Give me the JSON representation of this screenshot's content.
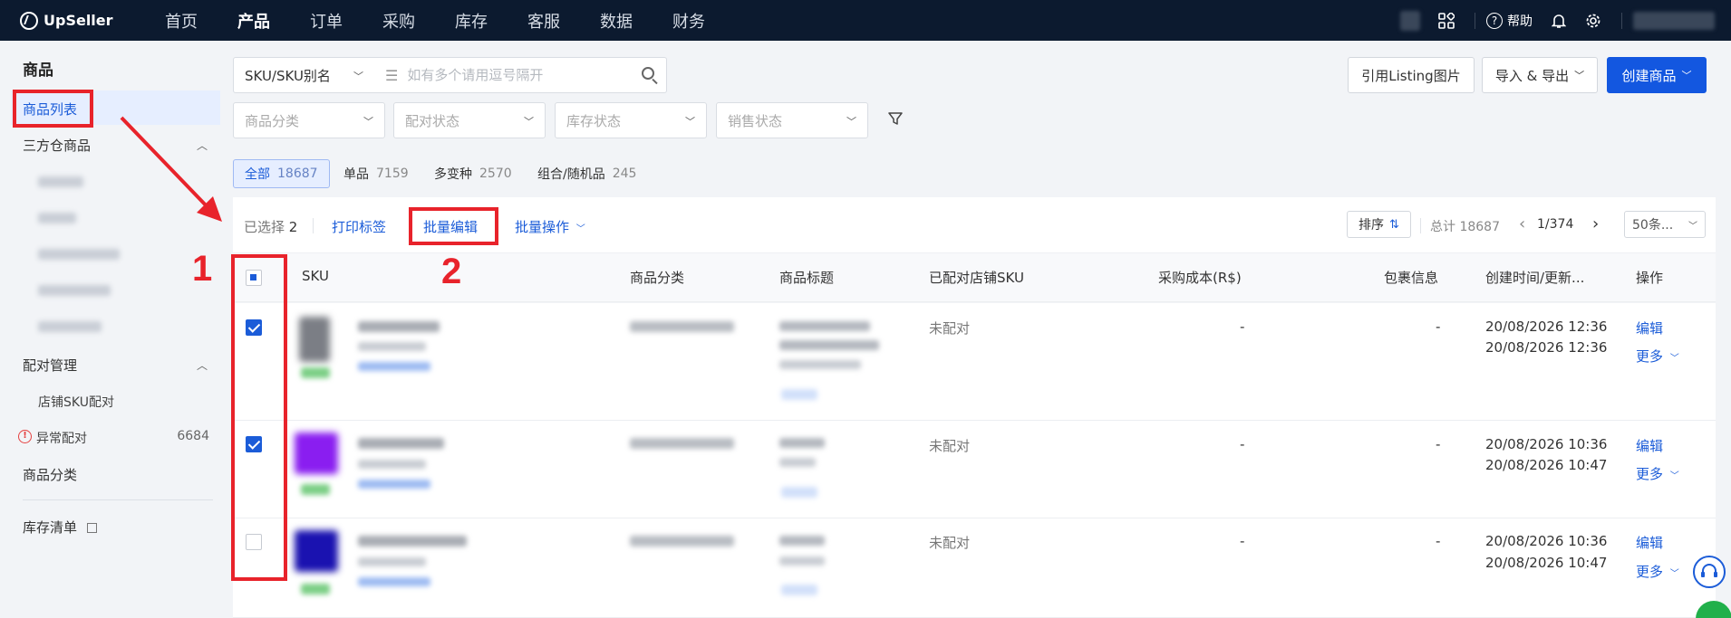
{
  "brand": "UpSeller",
  "nav": [
    "首页",
    "产品",
    "订单",
    "采购",
    "库存",
    "客服",
    "数据",
    "财务"
  ],
  "nav_active_index": 1,
  "topbar": {
    "help": "帮助"
  },
  "sidebar": {
    "title": "商品",
    "items": {
      "product_list": "商品列表",
      "third_party": "三方仓商品",
      "pairing": "配对管理",
      "store_sku": "店铺SKU配对",
      "abnormal": "异常配对",
      "abnormal_count": "6684",
      "category": "商品分类",
      "inventory": "库存清单"
    }
  },
  "filters": {
    "sku_type": "SKU/SKU别名",
    "search_placeholder": "如有多个请用逗号隔开",
    "category": "商品分类",
    "pair_status": "配对状态",
    "stock_status": "库存状态",
    "sale_status": "销售状态"
  },
  "buttons": {
    "use_listing": "引用Listing图片",
    "import_export": "导入 & 导出",
    "create": "创建商品"
  },
  "tabs": [
    {
      "label": "全部",
      "count": "18687"
    },
    {
      "label": "单品",
      "count": "7159"
    },
    {
      "label": "多变种",
      "count": "2570"
    },
    {
      "label": "组合/随机品",
      "count": "245"
    }
  ],
  "action_bar": {
    "selected_label": "已选择",
    "selected_count": "2",
    "print": "打印标签",
    "batch_edit": "批量编辑",
    "batch_ops": "批量操作",
    "sort": "排序",
    "total": "总计 18687",
    "page": "1/374",
    "page_size": "50条..."
  },
  "columns": [
    "SKU",
    "商品分类",
    "商品标题",
    "已配对店铺SKU",
    "采购成本(R$)",
    "包裹信息",
    "创建时间/更新...",
    "操作"
  ],
  "rows": [
    {
      "checked": true,
      "paired": "未配对",
      "cost": "-",
      "package": "-",
      "created": "20/08/2026 12:36",
      "updated": "20/08/2026 12:36",
      "edit": "编辑",
      "more": "更多"
    },
    {
      "checked": true,
      "paired": "未配对",
      "cost": "-",
      "package": "-",
      "created": "20/08/2026 10:36",
      "updated": "20/08/2026 10:47",
      "edit": "编辑",
      "more": "更多"
    },
    {
      "checked": false,
      "paired": "未配对",
      "cost": "-",
      "package": "-",
      "created": "20/08/2026 10:36",
      "updated": "20/08/2026 10:47",
      "edit": "编辑",
      "more": "更多"
    }
  ],
  "annotations": {
    "step1": "1",
    "step2": "2"
  },
  "colors": {
    "accent": "#1357e0",
    "annotation": "#e8232b",
    "nav_bg": "#0c1a2f"
  }
}
